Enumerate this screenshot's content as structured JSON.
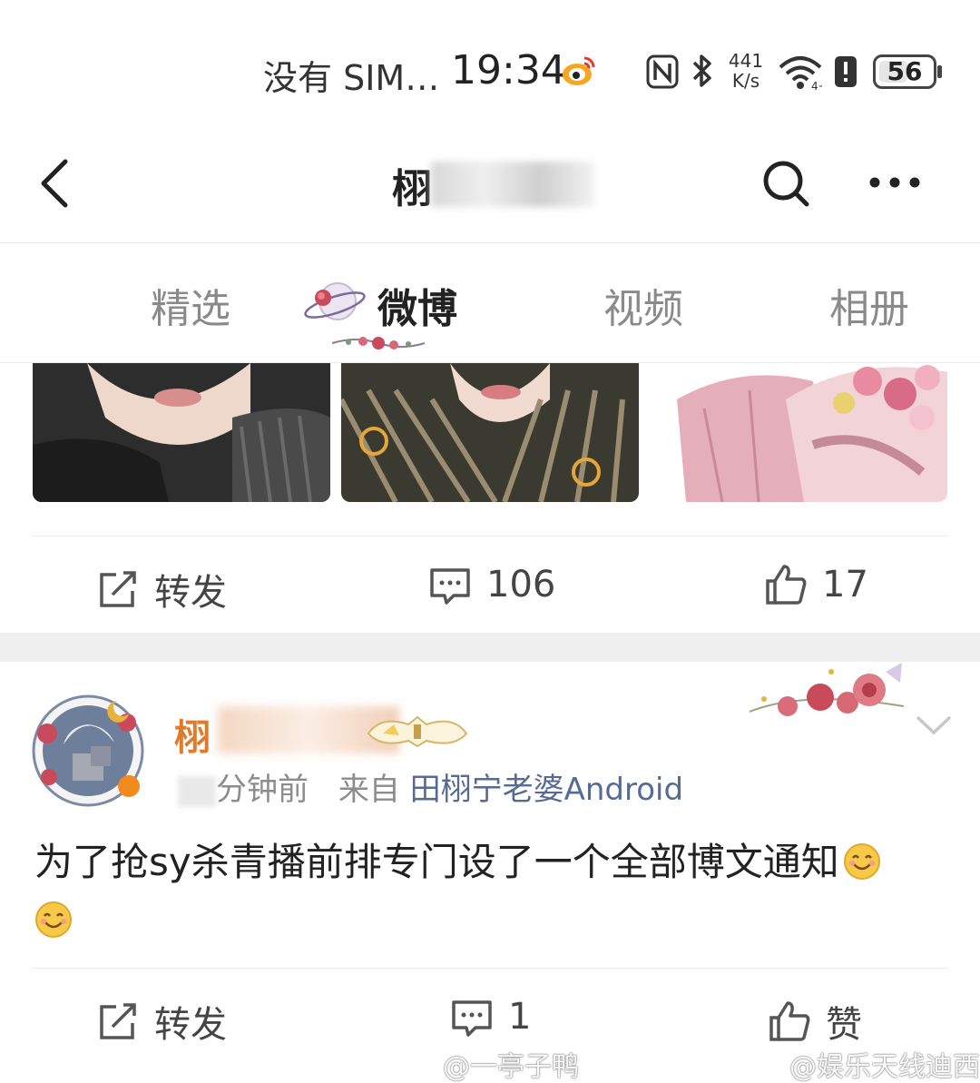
{
  "status_bar": {
    "carrier": "没有 SIM…",
    "time": "19:34",
    "net_speed_value": "441",
    "net_speed_unit": "K/s",
    "battery_level": 56,
    "battery_label": "56"
  },
  "header": {
    "title": "栩"
  },
  "tabs": [
    {
      "label": "精选",
      "active": false
    },
    {
      "label": "微博",
      "active": true
    },
    {
      "label": "视频",
      "active": false
    },
    {
      "label": "相册",
      "active": false
    }
  ],
  "previous_post": {
    "actions": {
      "repost_label": "转发",
      "comment_count": "106",
      "like_count": "17"
    }
  },
  "post": {
    "username": "栩",
    "meta_time_suffix": "分钟前",
    "meta_from_label": "来自",
    "meta_source": "田栩宁老婆Android",
    "text": "为了抢sy杀青播前排专门设了一个全部博文通知",
    "emoji": "smiling-face-emoji",
    "actions": {
      "repost_label": "转发",
      "comment_count": "1",
      "like_label": "赞"
    }
  },
  "watermarks": [
    "@一亭子鸭",
    "@娱乐天线迪西"
  ],
  "colors": {
    "accent_name": "#e07b2a",
    "source_link": "#566a94",
    "inactive_tab": "#8a8a8a"
  }
}
